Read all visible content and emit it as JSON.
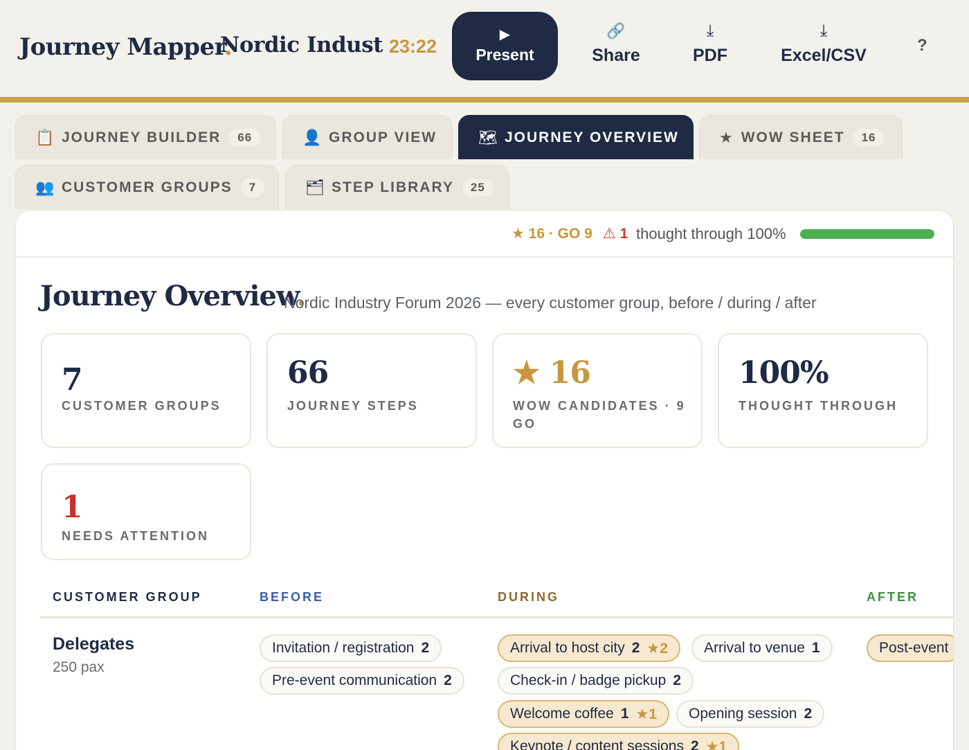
{
  "header": {
    "brand": "Journey Mapper",
    "brand_dot": ".",
    "project": "Nordic Indust",
    "timer": "23:22",
    "present": {
      "icon": "▶",
      "label": "Present"
    },
    "share": {
      "icon": "🔗",
      "label": "Share"
    },
    "pdf": {
      "icon": "⤓",
      "label": "PDF"
    },
    "excel": {
      "icon": "⤓",
      "label": "Excel/CSV"
    },
    "help": "?"
  },
  "tabs": [
    {
      "icon": "📋",
      "label": "JOURNEY BUILDER",
      "count": "66"
    },
    {
      "icon": "👤",
      "label": "GROUP VIEW",
      "count": ""
    },
    {
      "icon": "🗺",
      "label": "JOURNEY OVERVIEW",
      "count": "",
      "active": true
    },
    {
      "icon": "★",
      "label": "WOW SHEET",
      "count": "16"
    },
    {
      "icon": "👥",
      "label": "CUSTOMER GROUPS",
      "count": "7"
    },
    {
      "icon": "🗂",
      "label": "STEP LIBRARY",
      "count": "25"
    }
  ],
  "status": {
    "wow": "★ 16 · GO 9",
    "attention": "⚠ 1",
    "thought": "thought through 100%",
    "progress": 1.0,
    "progress_color": "#4caf50"
  },
  "page": {
    "title": "Journey Overview",
    "title_dot": ".",
    "subtitle": "Nordic Industry Forum 2026 — every customer group, before / during / after"
  },
  "stats": [
    {
      "value": "7",
      "label": "CUSTOMER GROUPS"
    },
    {
      "value": "66",
      "label": "JOURNEY STEPS"
    },
    {
      "value": "★ 16",
      "label": "WOW CANDIDATES · 9 GO"
    },
    {
      "value": "100%",
      "label": "THOUGHT THROUGH"
    },
    {
      "value": "1",
      "label": "NEEDS ATTENTION"
    }
  ],
  "table": {
    "headers": {
      "group": "CUSTOMER GROUP",
      "before": "BEFORE",
      "during": "DURING",
      "after": "AFTER"
    },
    "header_colors": {
      "group": "#1f2a44",
      "before": "#3b5da8",
      "during": "#8a6a2e",
      "after": "#3f8f3a"
    },
    "rows": [
      {
        "name": "Delegates",
        "pax": "250 pax",
        "before": [
          {
            "label": "Invitation / registration",
            "count": "2"
          },
          {
            "label": "Pre-event communication",
            "count": "2"
          }
        ],
        "during": [
          {
            "label": "Arrival to host city",
            "count": "2",
            "wow": "★2"
          },
          {
            "label": "Arrival to venue",
            "count": "1"
          },
          {
            "label": "Check-in / badge pickup",
            "count": "2"
          },
          {
            "label": "Welcome coffee",
            "count": "1",
            "wow": "★1"
          },
          {
            "label": "Opening session",
            "count": "2"
          },
          {
            "label": "Keynote / content sessions",
            "count": "2",
            "wow": "★1"
          }
        ],
        "after": [
          {
            "label": "Post-event"
          }
        ]
      }
    ]
  }
}
